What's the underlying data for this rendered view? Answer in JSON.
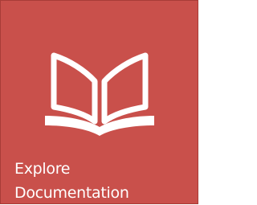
{
  "tile": {
    "label_line1": "Explore",
    "label_line2": "Documentation",
    "icon": "book-icon",
    "background_color": "#c9504b",
    "icon_color": "#ffffff"
  }
}
